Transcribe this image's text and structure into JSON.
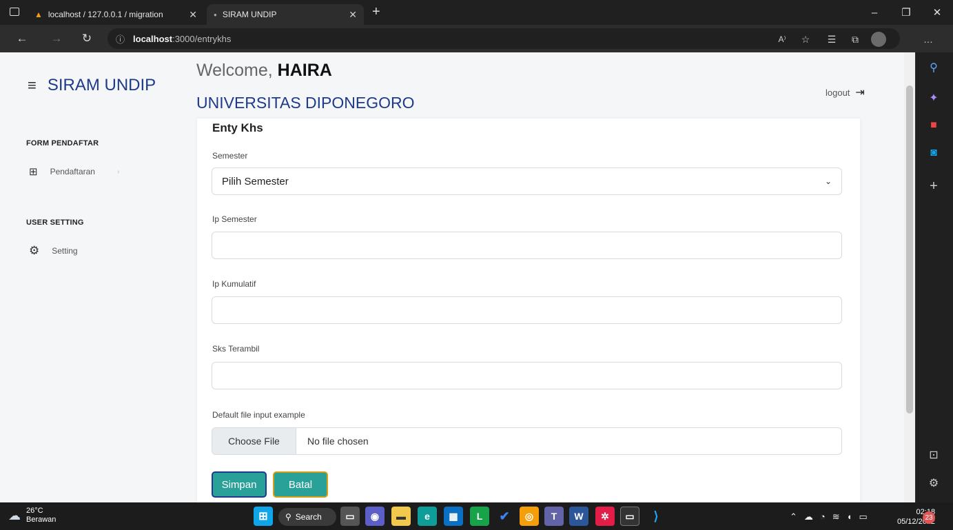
{
  "browser": {
    "tabs": [
      {
        "title": "localhost / 127.0.0.1 / migration"
      },
      {
        "title": "SIRAM UNDIP"
      }
    ],
    "url_host": "localhost",
    "url_path": ":3000/entrykhs"
  },
  "sidebar": {
    "brand": "SIRAM UNDIP",
    "sections": [
      {
        "heading": "FORM PENDAFTAR",
        "items": [
          {
            "label": "Pendaftaran",
            "icon": "form-icon"
          }
        ]
      },
      {
        "heading": "USER SETTING",
        "items": [
          {
            "label": "Setting",
            "icon": "gear-icon"
          }
        ]
      }
    ]
  },
  "header": {
    "welcome_prefix": "Welcome,",
    "user_name": "HAIRA",
    "university": "UNIVERSITAS DIPONEGORO",
    "logout_label": "logout"
  },
  "form": {
    "title": "Enty Khs",
    "semester_label": "Semester",
    "semester_value": "Pilih Semester",
    "ip_semester_label": "Ip Semester",
    "ip_kumulatif_label": "Ip Kumulatif",
    "sks_label": "Sks Terambil",
    "file_label": "Default file input example",
    "choose_file": "Choose File",
    "no_file": "No file chosen",
    "save_label": "Simpan",
    "cancel_label": "Batal"
  },
  "taskbar": {
    "temperature": "26°C",
    "weather_text": "Berawan",
    "search_label": "Search",
    "time": "02:18",
    "date": "05/12/2022",
    "notifications": "23"
  },
  "colors": {
    "brand": "#1e3a8a",
    "button": "#2aa198"
  }
}
